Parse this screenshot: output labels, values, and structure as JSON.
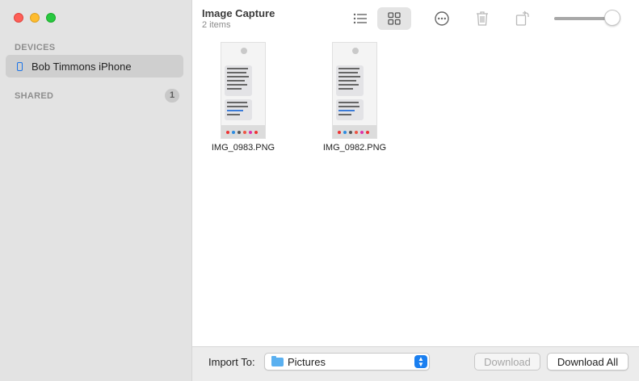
{
  "window": {
    "title": "Image Capture",
    "subtitle": "2 items"
  },
  "sidebar": {
    "devices_header": "DEVICES",
    "device_name": "Bob Timmons iPhone",
    "shared_header": "SHARED",
    "shared_count": "1"
  },
  "toolbar": {
    "icons": [
      "list-view-icon",
      "grid-view-icon",
      "more-icon",
      "trash-icon",
      "rotate-icon"
    ],
    "thumbnail_size_fraction": 0.95
  },
  "items": [
    {
      "filename": "IMG_0983.PNG"
    },
    {
      "filename": "IMG_0982.PNG"
    }
  ],
  "bottombar": {
    "import_label": "Import To:",
    "import_destination": "Pictures",
    "download_label": "Download",
    "download_all_label": "Download All"
  },
  "colors": {
    "close": "#fe5f57",
    "minimize": "#febc2e",
    "maximize": "#28c840",
    "accent": "#1a7ff0",
    "sidebar_bg": "#e3e3e3"
  }
}
